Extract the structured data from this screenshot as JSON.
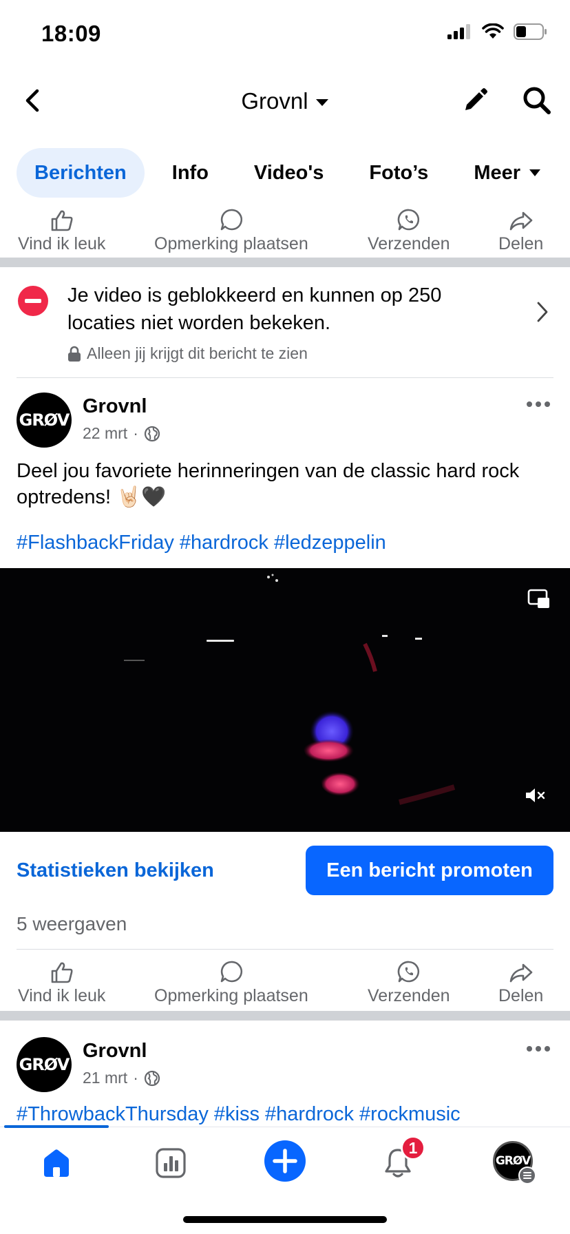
{
  "status": {
    "time": "18:09"
  },
  "nav": {
    "title": "Grovnl"
  },
  "tabs": [
    {
      "label": "Berichten"
    },
    {
      "label": "Info"
    },
    {
      "label": "Video's"
    },
    {
      "label": "Foto’s"
    },
    {
      "label": "Meer"
    }
  ],
  "actions": {
    "like": "Vind ik leuk",
    "comment": "Opmerking plaatsen",
    "send": "Verzenden",
    "share": "Delen"
  },
  "notice": {
    "text": "Je video is geblokkeerd en kunnen op 250 locaties niet worden bekeken.",
    "sub": "Alleen jij krijgt dit bericht te zien"
  },
  "avatar_text": "GRØV",
  "post1": {
    "author": "Grovnl",
    "date": "22 mrt",
    "text": "Deel jou favoriete herinneringen van de classic hard rock optredens! 🤘🏻🖤",
    "hashtags": "#FlashbackFriday #hardrock #ledzeppelin"
  },
  "post_stats": {
    "stats_link": "Statistieken bekijken",
    "promote": "Een bericht promoten",
    "views": "5 weergaven"
  },
  "post2": {
    "author": "Grovnl",
    "date": "21 mrt",
    "hashtags": "#ThrowbackThursday #kiss #hardrock #rockmusic"
  },
  "bottom_nav": {
    "notifications_badge": "1"
  },
  "colors": {
    "accent": "#0866ff",
    "link": "#0a66d8",
    "badge": "#e41e3f",
    "blocked": "#f02849"
  }
}
